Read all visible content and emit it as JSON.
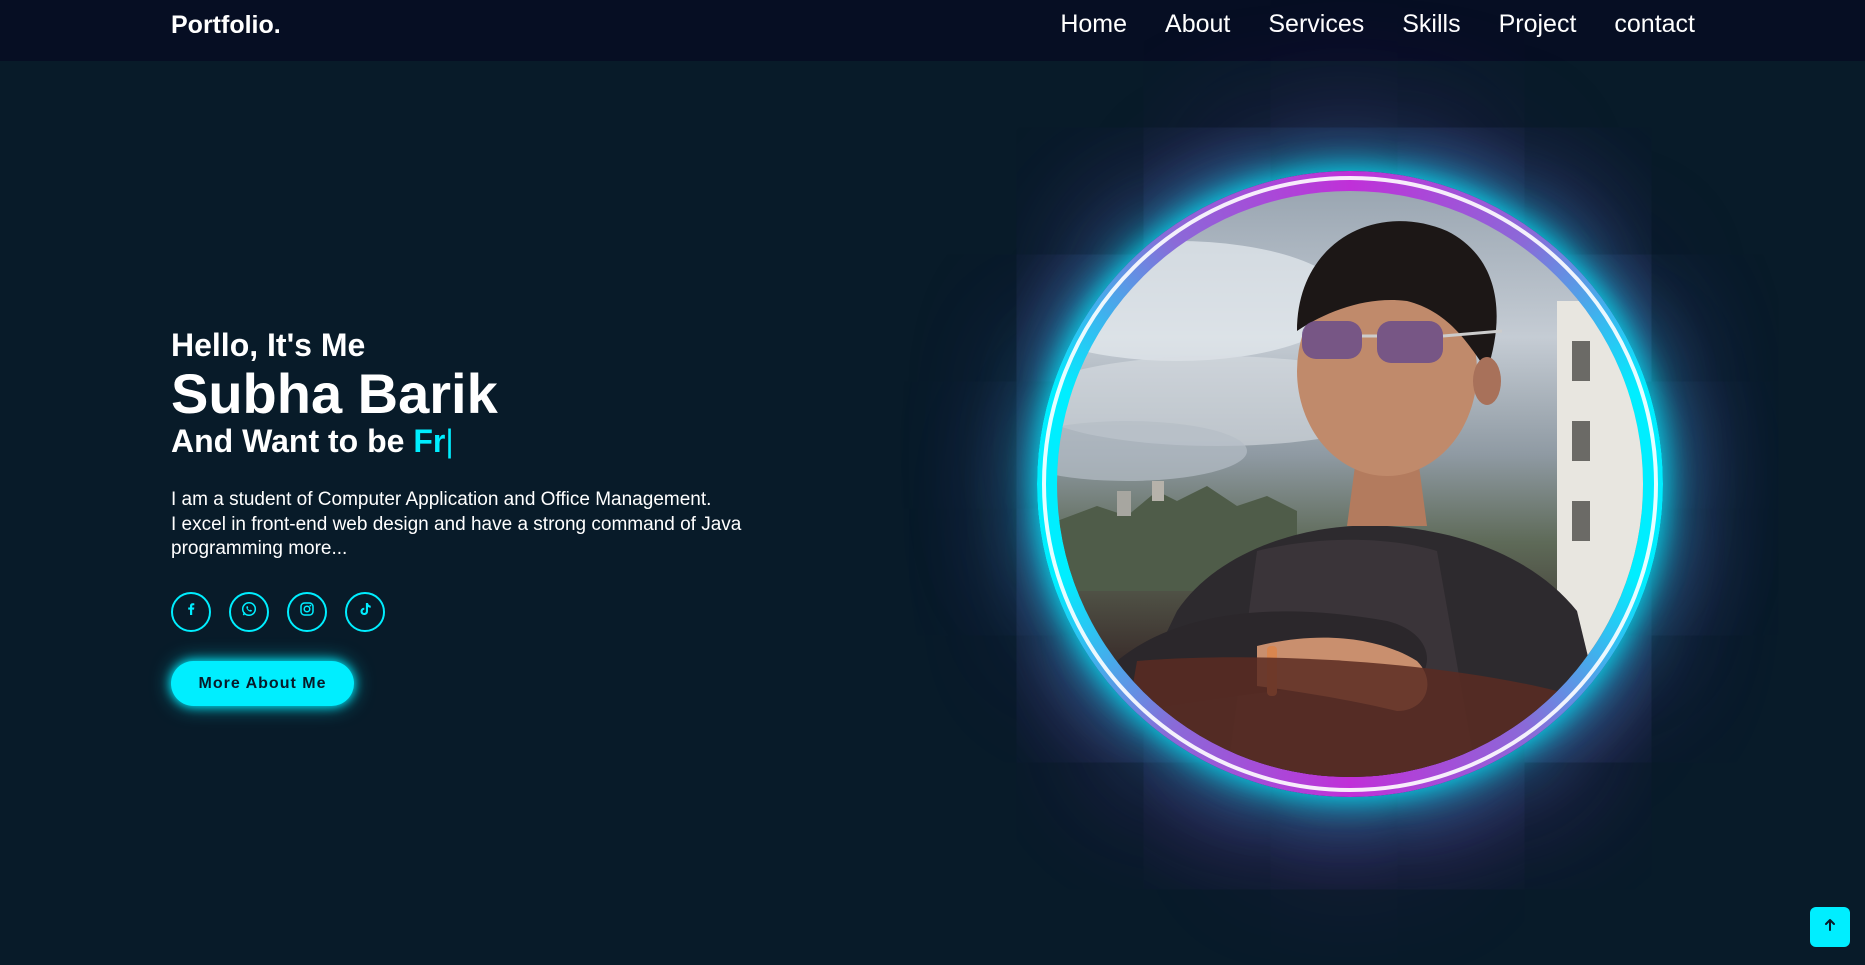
{
  "header": {
    "logo": "Portfolio.",
    "nav": [
      "Home",
      "About",
      "Services",
      "Skills",
      "Project",
      "contact"
    ]
  },
  "home": {
    "greeting": "Hello, It's Me",
    "name": "Subha Barik",
    "want_prefix": "And Want to be ",
    "typed_text": "Fr",
    "caret": "|",
    "bio": [
      "I am a student of Computer Application and Office Management.",
      "I excel in front-end web design and have a strong command of Java",
      "programming more..."
    ],
    "social_icons": [
      "facebook-icon",
      "whatsapp-icon",
      "instagram-icon",
      "tiktok-icon"
    ],
    "button_label": "More About Me"
  },
  "colors": {
    "background": "#081b29",
    "header": "#060e23",
    "accent": "#00eeff",
    "glow_secondary": "#c030d8"
  },
  "scroll_top_icon": "arrow-up-icon"
}
